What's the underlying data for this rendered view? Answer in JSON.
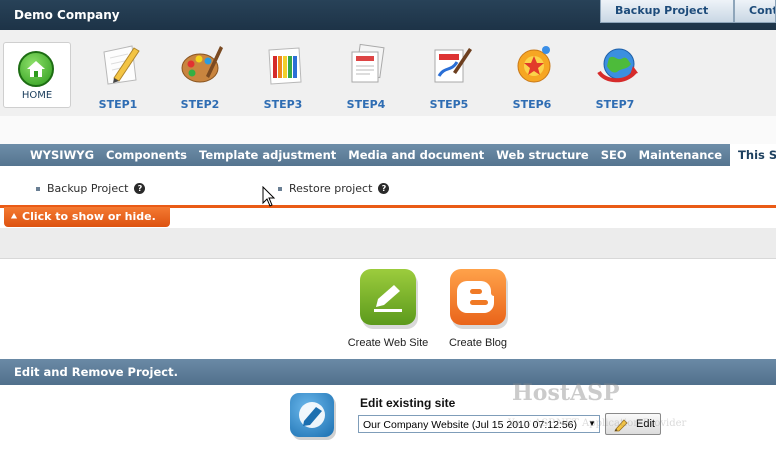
{
  "header": {
    "company": "Demo Company",
    "tabs": [
      "Backup Project",
      "Cont"
    ]
  },
  "toolbar": {
    "home_label": "HOME",
    "steps": [
      {
        "label": "STEP1",
        "icon": "pencil-paper-icon"
      },
      {
        "label": "STEP2",
        "icon": "paint-palette-icon"
      },
      {
        "label": "STEP3",
        "icon": "color-swatches-icon"
      },
      {
        "label": "STEP4",
        "icon": "documents-icon"
      },
      {
        "label": "STEP5",
        "icon": "paint-brush-document-icon"
      },
      {
        "label": "STEP6",
        "icon": "star-burst-icon"
      },
      {
        "label": "STEP7",
        "icon": "globe-arrow-icon"
      }
    ]
  },
  "menu": {
    "items": [
      "WYSIWYG",
      "Components",
      "Template adjustment",
      "Media and document",
      "Web structure",
      "SEO",
      "Maintenance"
    ],
    "active": "This St"
  },
  "sublinks": {
    "backup": "Backup Project",
    "restore": "Restore project",
    "help_glyph": "?"
  },
  "toggle": {
    "label": "Click to show or hide."
  },
  "create": {
    "website_label": "Create Web Site",
    "blog_label": "Create Blog"
  },
  "section": {
    "title": "Edit and Remove Project."
  },
  "edit": {
    "title": "Edit existing site",
    "selected_site": "Our Company Website (Jul 15 2010 07:12:56)",
    "button_label": "Edit"
  },
  "watermark": {
    "text": "HostASP",
    "subtext": "Your ASP.NET Application Provider"
  },
  "colors": {
    "accent_orange": "#ea5b16",
    "menu_blue": "#5f7f9b",
    "step_blue": "#2f6db3",
    "title_dark": "#284258"
  }
}
